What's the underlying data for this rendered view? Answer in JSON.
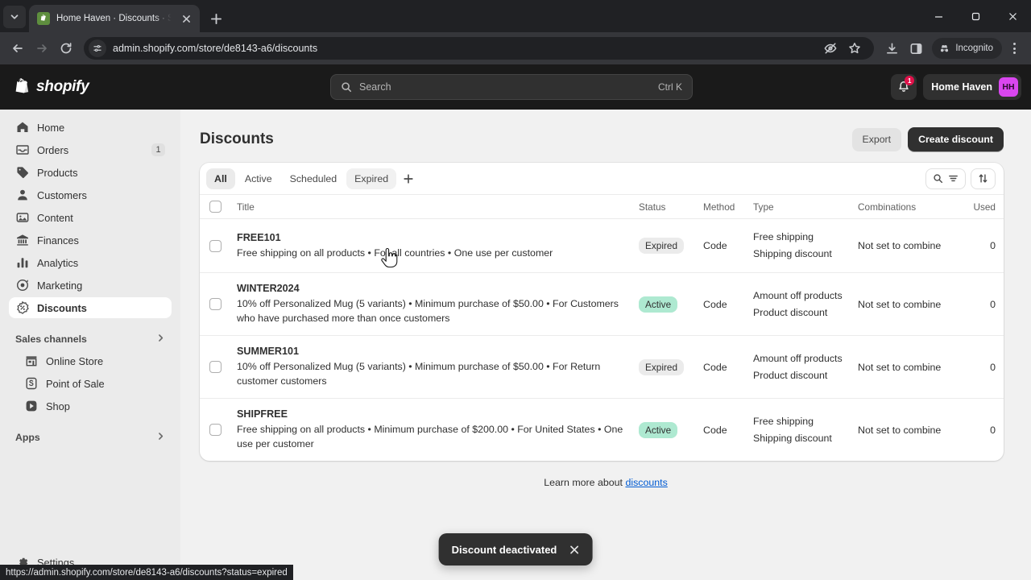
{
  "browser": {
    "tab": {
      "title": "Home Haven · Discounts · Shop",
      "favicon": "shopify-bag-icon"
    },
    "url": "admin.shopify.com/store/de8143-a6/discounts",
    "incognito_label": "Incognito",
    "status_link": "https://admin.shopify.com/store/de8143-a6/discounts?status=expired"
  },
  "topbar": {
    "logo_word": "shopify",
    "search": {
      "placeholder": "Search",
      "shortcut": "Ctrl K",
      "value": ""
    },
    "notifications_count": "1",
    "store_name": "Home Haven",
    "avatar_initials": "HH",
    "avatar_color": "#d946ef"
  },
  "sidebar": {
    "items": [
      {
        "label": "Home",
        "icon": "home-icon",
        "badge": "",
        "active": false
      },
      {
        "label": "Orders",
        "icon": "orders-icon",
        "badge": "1",
        "active": false
      },
      {
        "label": "Products",
        "icon": "products-tag-icon",
        "badge": "",
        "active": false
      },
      {
        "label": "Customers",
        "icon": "customers-person-icon",
        "badge": "",
        "active": false
      },
      {
        "label": "Content",
        "icon": "content-image-icon",
        "badge": "",
        "active": false
      },
      {
        "label": "Finances",
        "icon": "finances-bank-icon",
        "badge": "",
        "active": false
      },
      {
        "label": "Analytics",
        "icon": "analytics-bars-icon",
        "badge": "",
        "active": false
      },
      {
        "label": "Marketing",
        "icon": "marketing-megaphone-icon",
        "badge": "",
        "active": false
      },
      {
        "label": "Discounts",
        "icon": "discounts-percent-icon",
        "badge": "",
        "active": true
      }
    ],
    "sales_channels_label": "Sales channels",
    "channels": [
      {
        "label": "Online Store",
        "icon": "storefront-icon"
      },
      {
        "label": "Point of Sale",
        "icon": "pos-icon"
      },
      {
        "label": "Shop",
        "icon": "shop-icon"
      }
    ],
    "apps_label": "Apps",
    "settings_label": "Settings"
  },
  "page": {
    "title": "Discounts",
    "export_label": "Export",
    "create_label": "Create discount",
    "learn_prefix": "Learn more about ",
    "learn_link": "discounts"
  },
  "tabs": [
    {
      "label": "All",
      "state": "selected"
    },
    {
      "label": "Active",
      "state": "default"
    },
    {
      "label": "Scheduled",
      "state": "default"
    },
    {
      "label": "Expired",
      "state": "hovered"
    }
  ],
  "table": {
    "columns": [
      "Title",
      "Status",
      "Method",
      "Type",
      "Combinations",
      "Used"
    ],
    "rows": [
      {
        "code": "FREE101",
        "desc": "Free shipping on all products • For all countries • One use per customer",
        "status": "Expired",
        "status_kind": "expired",
        "method": "Code",
        "type_line1": "Free shipping",
        "type_line2": "Shipping discount",
        "combinations": "Not set to combine",
        "used": "0"
      },
      {
        "code": "WINTER2024",
        "desc": "10% off Personalized Mug (5 variants) • Minimum purchase of $50.00 • For Customers who have purchased more than once customers",
        "status": "Active",
        "status_kind": "active",
        "method": "Code",
        "type_line1": "Amount off products",
        "type_line2": "Product discount",
        "combinations": "Not set to combine",
        "used": "0"
      },
      {
        "code": "SUMMER101",
        "desc": "10% off Personalized Mug (5 variants) • Minimum purchase of $50.00 • For Return customer customers",
        "status": "Expired",
        "status_kind": "expired",
        "method": "Code",
        "type_line1": "Amount off products",
        "type_line2": "Product discount",
        "combinations": "Not set to combine",
        "used": "0"
      },
      {
        "code": "SHIPFREE",
        "desc": "Free shipping on all products • Minimum purchase of $200.00 • For United States • One use per customer",
        "status": "Active",
        "status_kind": "active",
        "method": "Code",
        "type_line1": "Free shipping",
        "type_line2": "Shipping discount",
        "combinations": "Not set to combine",
        "used": "0"
      }
    ]
  },
  "toast": {
    "message": "Discount deactivated"
  },
  "colors": {
    "active_badge": "#aee9d1",
    "expired_badge": "#ebebeb",
    "link": "#005bd3",
    "brand_dark": "#1a1a1a"
  }
}
